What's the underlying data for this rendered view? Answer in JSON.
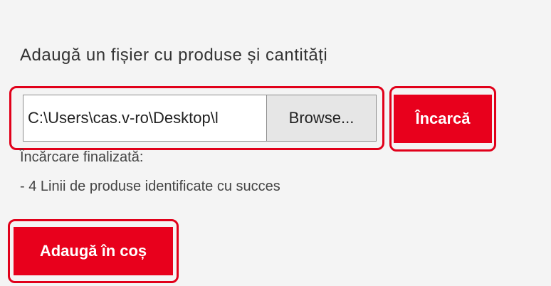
{
  "upload_section": {
    "title": "Adaugă un fișier cu produse și cantități",
    "file_path": "C:\\Users\\cas.v-ro\\Desktop\\l",
    "browse_label": "Browse...",
    "upload_label": "Încarcă"
  },
  "status": {
    "line1": "Încărcare finalizată:",
    "line2": "- 4 Linii de produse identificate cu succes"
  },
  "cart": {
    "add_label": "Adaugă în coș"
  },
  "colors": {
    "accent": "#e8001c",
    "highlight": "#e1001a",
    "background": "#f4f4f4"
  }
}
